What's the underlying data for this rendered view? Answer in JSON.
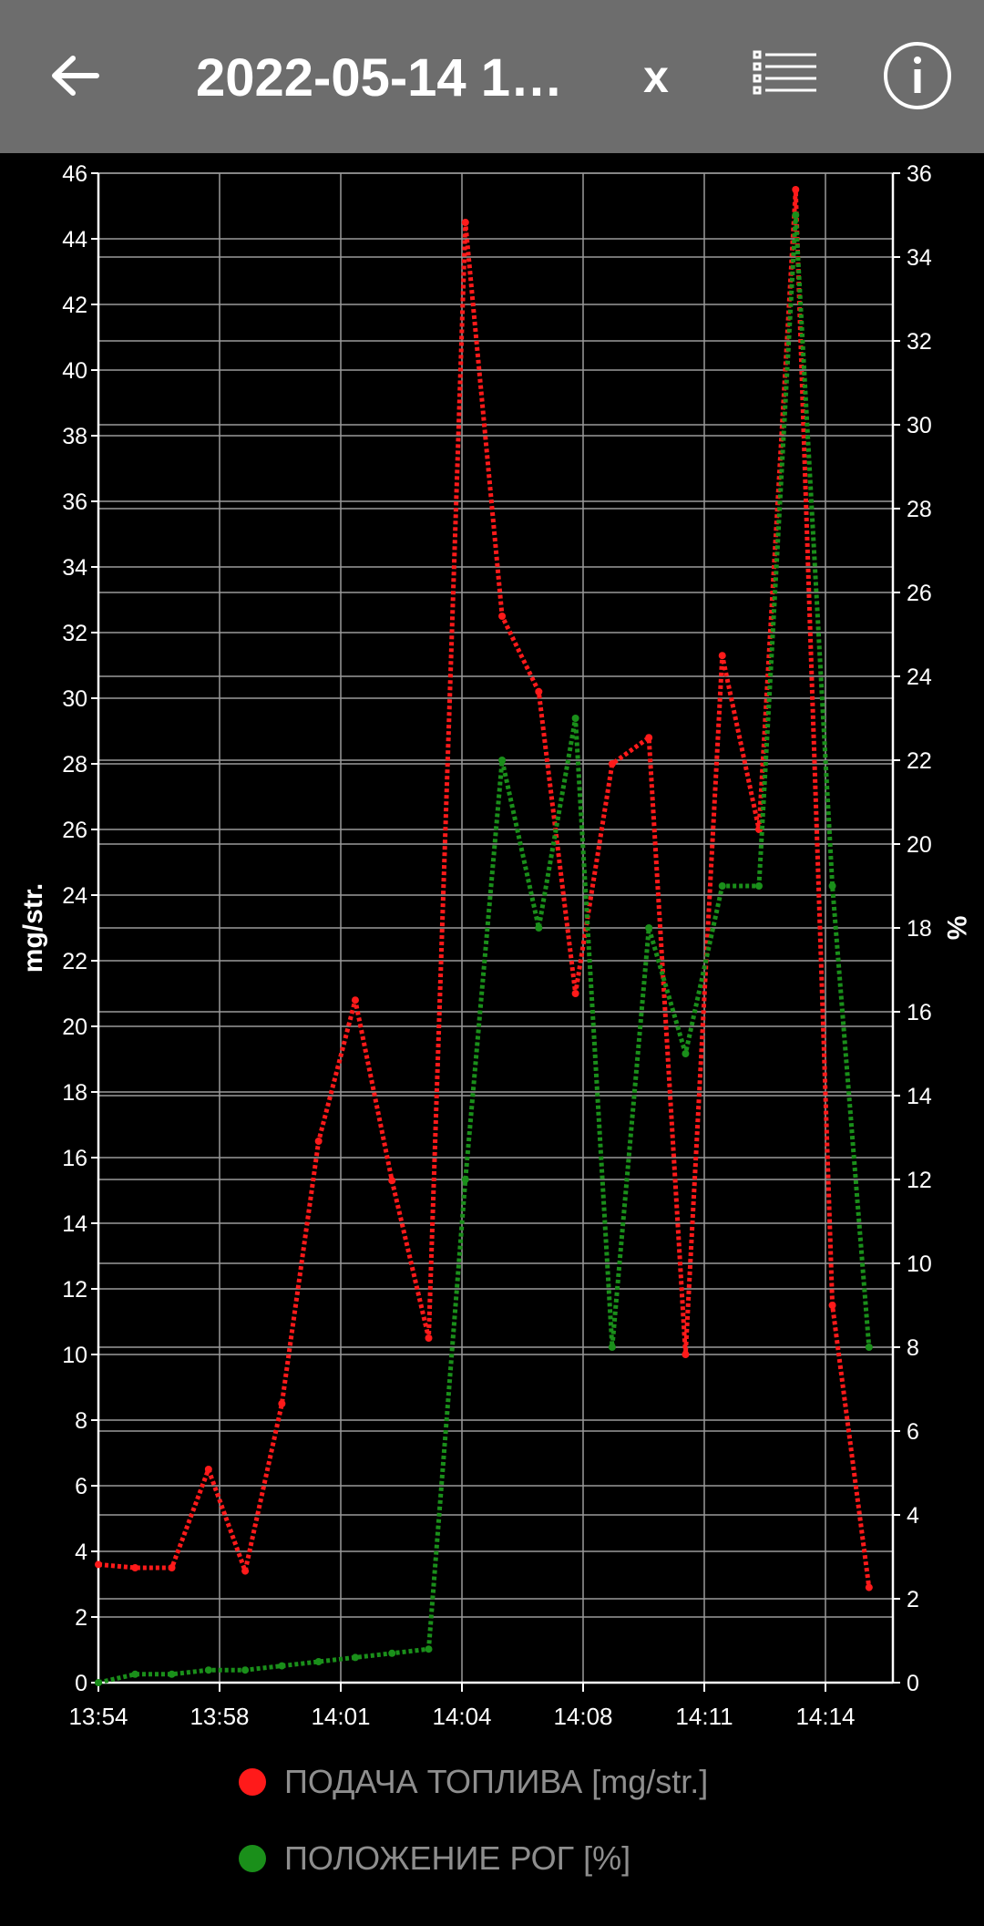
{
  "header": {
    "title": "2022-05-14 1…",
    "close_label": "x",
    "back_icon": "arrow-left-icon",
    "list_icon": "list-icon",
    "info_icon": "info-icon",
    "background": "#6d6d6d"
  },
  "chart_data": {
    "type": "line",
    "x_tick_labels": [
      "13:54",
      "13:58",
      "14:01",
      "14:04",
      "14:08",
      "14:11",
      "14:14"
    ],
    "x": [
      "13:54",
      "13:55",
      "13:56",
      "13:57",
      "13:58",
      "13:59",
      "14:00",
      "14:01",
      "14:02",
      "14:03",
      "14:04",
      "14:05",
      "14:06",
      "14:07",
      "14:08",
      "14:09",
      "14:10",
      "14:11",
      "14:12",
      "14:13",
      "14:14",
      "14:15"
    ],
    "ylabel": "mg/str.",
    "ylabel_right": "%",
    "ylim": [
      0,
      46
    ],
    "ylim_right": [
      0,
      36
    ],
    "y_ticks": [
      0,
      2,
      4,
      6,
      8,
      10,
      12,
      14,
      16,
      18,
      20,
      22,
      24,
      26,
      28,
      30,
      32,
      34,
      36,
      38,
      40,
      42,
      44,
      46
    ],
    "y_ticks_right": [
      0,
      2,
      4,
      6,
      8,
      10,
      12,
      14,
      16,
      18,
      20,
      22,
      24,
      26,
      28,
      30,
      32,
      34,
      36
    ],
    "grid": true,
    "series": [
      {
        "name": "ПОДАЧА ТОПЛИВА [mg/str.]",
        "axis": "left",
        "color": "#ff1a1a",
        "values": [
          3.6,
          3.5,
          3.5,
          6.5,
          3.4,
          8.5,
          16.5,
          20.8,
          15.3,
          10.5,
          44.5,
          32.5,
          30.2,
          21.0,
          28.0,
          28.8,
          10.0,
          31.3,
          26.0,
          45.5,
          11.5,
          2.9
        ]
      },
      {
        "name": "ПОЛОЖЕНИЕ РОГ [%]",
        "axis": "right",
        "color": "#1a8f1a",
        "values": [
          0.0,
          0.2,
          0.2,
          0.3,
          0.3,
          0.4,
          0.5,
          0.6,
          0.7,
          0.8,
          12.0,
          22.0,
          18.0,
          23.0,
          8.0,
          18.0,
          15.0,
          19.0,
          19.0,
          35.0,
          19.0,
          8.0
        ]
      }
    ]
  }
}
